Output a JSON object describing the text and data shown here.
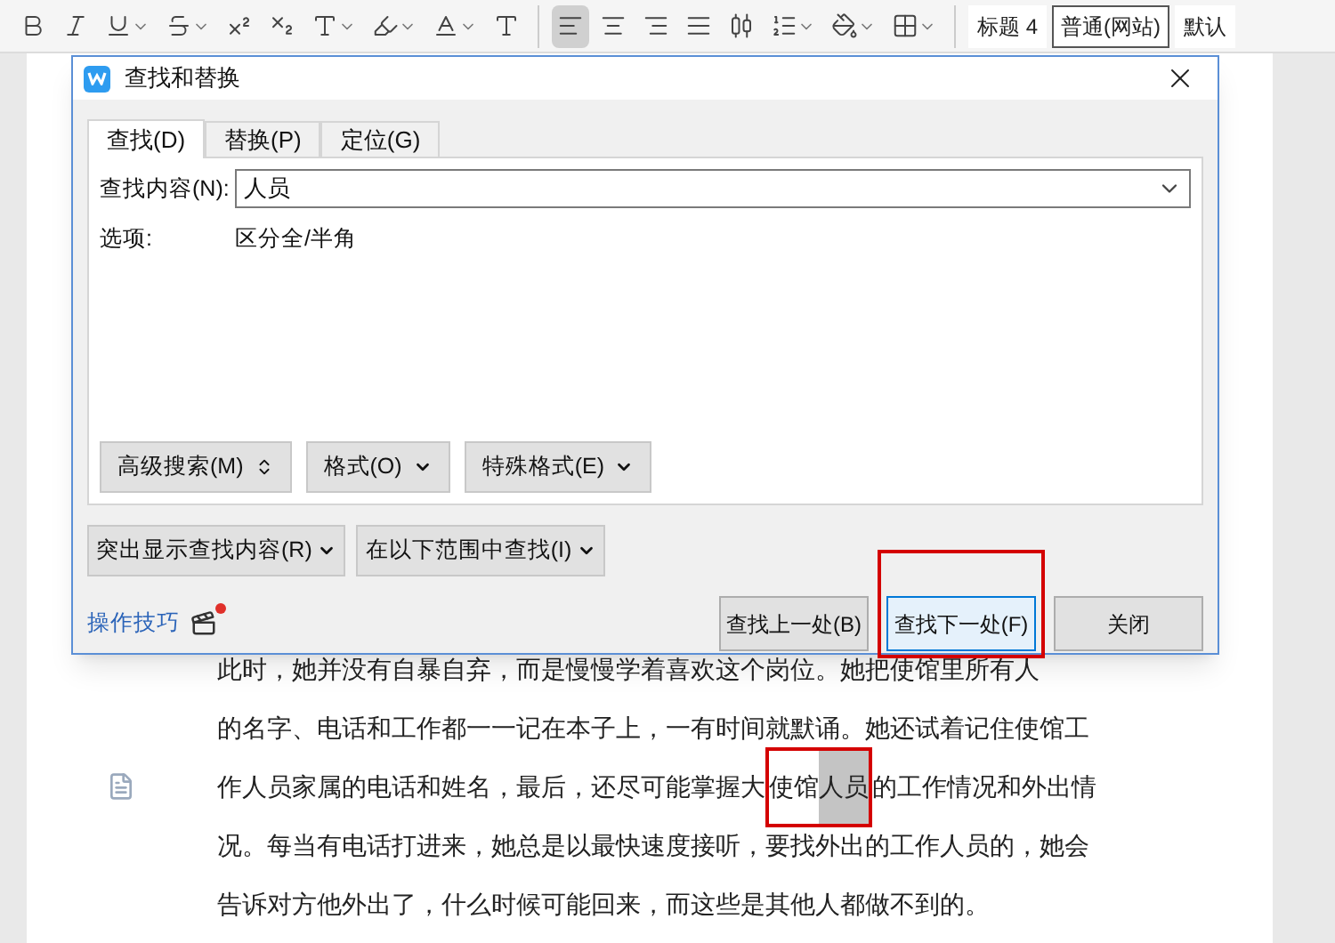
{
  "toolbar": {
    "format_tools": [
      {
        "kind": "bold",
        "menu": false
      },
      {
        "kind": "italic",
        "menu": false
      },
      {
        "kind": "underline",
        "menu": true
      },
      {
        "kind": "strike",
        "menu": true
      },
      {
        "kind": "superscript",
        "menu": false
      },
      {
        "kind": "subscript",
        "menu": false
      },
      {
        "kind": "text-effect",
        "menu": true
      },
      {
        "kind": "highlight",
        "menu": true
      },
      {
        "kind": "font-color",
        "menu": true
      },
      {
        "kind": "char-shading",
        "menu": false
      }
    ],
    "paragraph_tools": [
      {
        "kind": "align-left",
        "selected": true,
        "menu": false
      },
      {
        "kind": "align-center",
        "selected": false,
        "menu": false
      },
      {
        "kind": "align-right",
        "selected": false,
        "menu": false
      },
      {
        "kind": "justify",
        "selected": false,
        "menu": false
      },
      {
        "kind": "distribute",
        "selected": false,
        "menu": false
      },
      {
        "kind": "line-spacing",
        "selected": false,
        "menu": true
      },
      {
        "kind": "shading",
        "selected": false,
        "menu": true
      },
      {
        "kind": "borders",
        "selected": false,
        "menu": true
      }
    ],
    "styles": [
      {
        "label": "标题 4",
        "selected": false
      },
      {
        "label": "普通(网站)",
        "selected": true
      },
      {
        "label": "默认",
        "selected": false
      }
    ]
  },
  "document": {
    "lines": [
      {
        "parts": [
          {
            "text": "此时，她并没有自暴自弃，而是慢慢学着喜欢这个岗位。她把使馆里所有人",
            "highlighted": false,
            "framed": false
          }
        ]
      },
      {
        "parts": [
          {
            "text": "的名字、电话和工作都一一记在本子上，一有时间就默诵。她还试着记住使馆工",
            "highlighted": false,
            "framed": false
          }
        ]
      },
      {
        "parts": [
          {
            "text": "作人员家属的电话和姓名，最后，还尽可能掌握大",
            "highlighted": false,
            "framed": false
          },
          {
            "text": "使馆",
            "highlighted": false,
            "framed": true
          },
          {
            "text": "人员",
            "highlighted": true,
            "framed": true
          },
          {
            "text": "的工作情况和外出情",
            "highlighted": false,
            "framed": false
          }
        ]
      },
      {
        "parts": [
          {
            "text": "况。每当有电话打进来，她总是以最快速度接听，要找外出的工作人员的，她会",
            "highlighted": false,
            "framed": false
          }
        ]
      },
      {
        "parts": [
          {
            "text": "告诉对方他外出了，什么时候可能回来，而这些是其他人都做不到的。",
            "highlighted": false,
            "framed": false
          }
        ]
      }
    ]
  },
  "dialog": {
    "title": "查找和替换",
    "tabs": [
      {
        "label": "查找(D)",
        "selected": true
      },
      {
        "label": "替换(P)",
        "selected": false
      },
      {
        "label": "定位(G)",
        "selected": false
      }
    ],
    "find_label": "查找内容(N):",
    "find_value": "人员",
    "options_label": "选项:",
    "options_value": "区分全/半角",
    "format_buttons": [
      {
        "label": "高级搜索(M)",
        "kind": "expand"
      },
      {
        "label": "格式(O)",
        "kind": "menu"
      },
      {
        "label": "特殊格式(E)",
        "kind": "menu"
      }
    ],
    "scope_buttons": [
      {
        "label": "突出显示查找内容(R)"
      },
      {
        "label": "在以下范围中查找(I)"
      }
    ],
    "tips_link": "操作技巧",
    "tips_badge": true,
    "actions": [
      {
        "label": "查找上一处(B)",
        "focused": false,
        "framed": false
      },
      {
        "label": "查找下一处(F)",
        "focused": true,
        "framed": true
      },
      {
        "label": "关闭",
        "focused": false,
        "framed": false
      }
    ]
  }
}
